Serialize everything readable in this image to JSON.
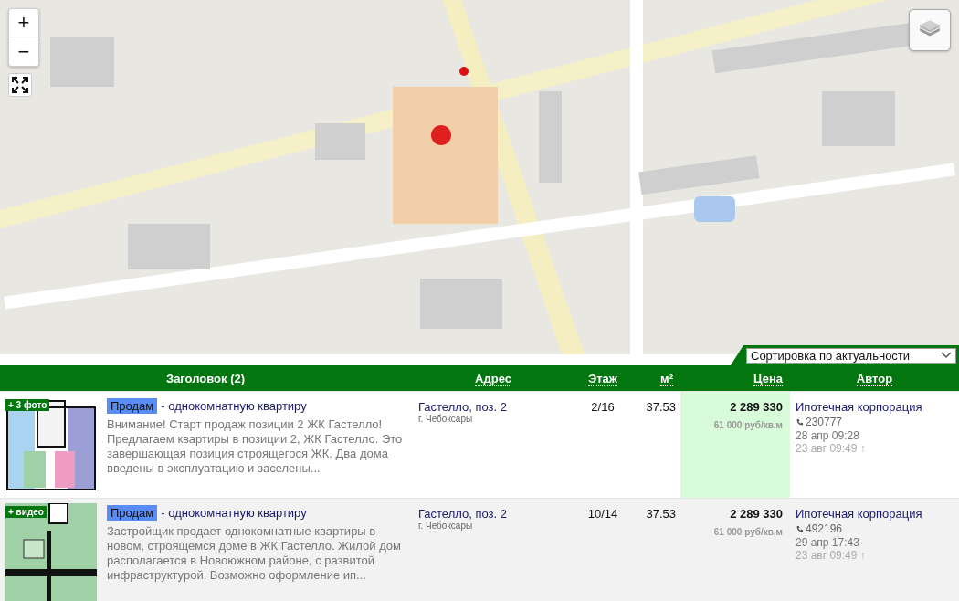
{
  "map": {
    "kind": "picture",
    "controls": {
      "zoom_in": "+",
      "zoom_out": "−"
    }
  },
  "sort": {
    "value": "Сортировка по актуальности"
  },
  "columns": [
    {
      "label": "Заголовок (2)",
      "sortable": false
    },
    {
      "label": "Адрес",
      "sortable": true
    },
    {
      "label": "Этаж",
      "sortable": true
    },
    {
      "label": "м²",
      "sortable": true
    },
    {
      "label": "Цена",
      "sortable": true
    },
    {
      "label": "Автор",
      "sortable": true
    }
  ],
  "rows": [
    {
      "badge": "+ 3 фото",
      "deal": "Продам",
      "title": "- однокомнатную квартиру",
      "description": "Внимание! Старт продаж позиции 2 ЖК Гастелло! Предлагаем квартиры в позиции 2, ЖК Гастелло. Это завершающая позиция строящегося ЖК. Два дома введены в эксплуатацию и заселены...",
      "address": "Гастелло, поз. 2",
      "city": "г. Чебоксары",
      "floor": "2/16",
      "area": "37.53",
      "price": "2 289 330",
      "price_per_m": "61 000 руб/кв.м",
      "price_highlighted": true,
      "author": "Ипотечная корпорация",
      "phone": "230777",
      "created": "28 апр 09:28",
      "updated": "23 авг 09:49 ↑"
    },
    {
      "badge": "+ видео",
      "deal": "Продам",
      "title": "- однокомнатную квартиру",
      "description": "Застройщик продает однокомнатные квартиры в новом, строящемся доме в ЖК Гастелло. Жилой дом располагается в Новоюжном районе, с развитой инфраструктурой. Возможно оформление ип...",
      "address": "Гастелло, поз. 2",
      "city": "г. Чебоксары",
      "floor": "10/14",
      "area": "37.53",
      "price": "2 289 330",
      "price_per_m": "61 000 руб/кв.м",
      "price_highlighted": false,
      "author": "Ипотечная корпорация",
      "phone": "492196",
      "created": "29 апр 17:43",
      "updated": "23 авг 09:49 ↑"
    }
  ]
}
